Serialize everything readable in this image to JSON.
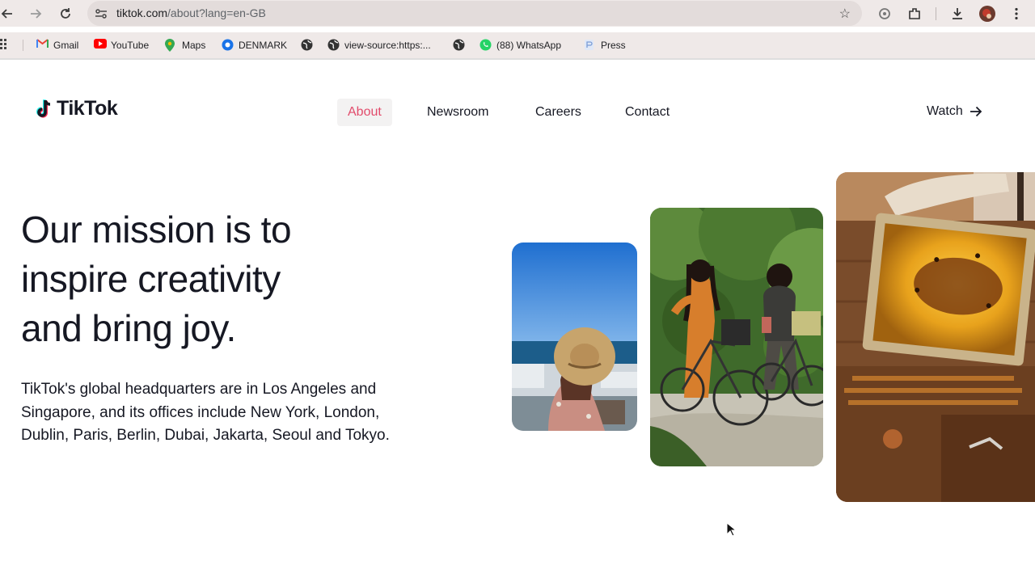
{
  "browser": {
    "url_host": "tiktok.com",
    "url_path": "/about?lang=en-GB"
  },
  "bookmarks": [
    {
      "label": "Gmail",
      "icon": "gmail-icon"
    },
    {
      "label": "YouTube",
      "icon": "youtube-icon"
    },
    {
      "label": "Maps",
      "icon": "maps-icon"
    },
    {
      "label": "DENMARK",
      "icon": "globe-icon"
    },
    {
      "label": "",
      "icon": "globe-icon"
    },
    {
      "label": "view-source:https:...",
      "icon": "globe-icon"
    },
    {
      "label": "",
      "icon": "globe-icon"
    },
    {
      "label": "(88) WhatsApp",
      "icon": "whatsapp-icon"
    },
    {
      "label": "Press",
      "icon": "press-icon"
    }
  ],
  "site": {
    "logo_text": "TikTok",
    "nav": [
      {
        "label": "About",
        "active": true
      },
      {
        "label": "Newsroom",
        "active": false
      },
      {
        "label": "Careers",
        "active": false
      },
      {
        "label": "Contact",
        "active": false
      }
    ],
    "watch_label": "Watch",
    "headline_lines": [
      "Our mission is to",
      "inspire creativity",
      "and bring joy."
    ],
    "body": "TikTok's global headquarters are in Los Angeles and Singapore, and its offices include New York, London, Dublin, Paris, Berlin, Dubai, Jakarta, Seoul and Tokyo."
  },
  "colors": {
    "accent": "#e24c6c",
    "text": "#161823",
    "chrome": "#efe9e8"
  }
}
